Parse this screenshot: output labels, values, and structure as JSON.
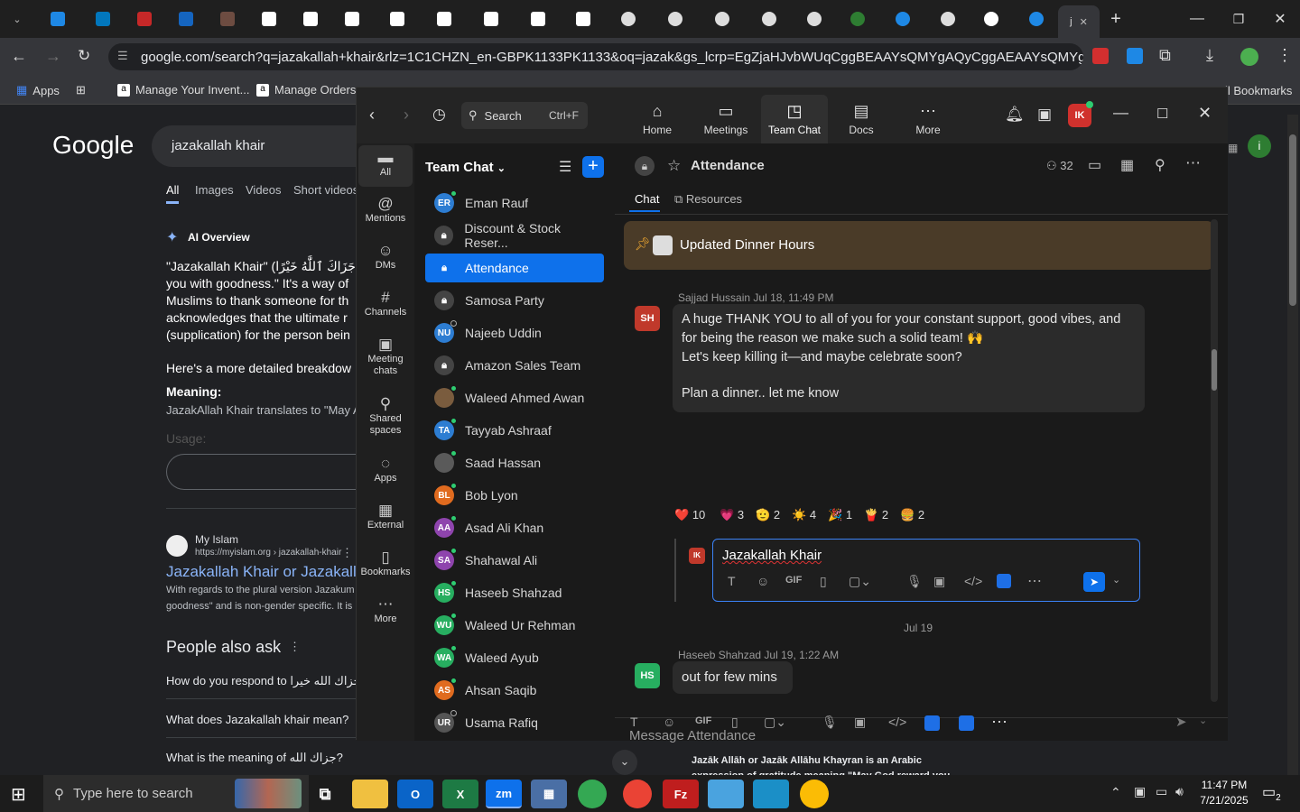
{
  "browser": {
    "url": "google.com/search?q=jazakallah+khair&rlz=1C1CHZN_en-GBPK1133PK1133&oq=jazak&gs_lcrp=EgZjaHJvbWUqCggBEAAYsQMYgAQyCggAEAAYsQMYg...",
    "bookmarks": [
      "Apps",
      "Manage Your Invent...",
      "Manage Orders",
      "All Bookmarks"
    ]
  },
  "google": {
    "search_query": "jazakallah khair",
    "tabs": [
      "All",
      "Images",
      "Videos",
      "Short videos"
    ],
    "ai_overview_label": "AI Overview",
    "overview_lines": [
      "\"Jazakallah Khair\" (جَزَاكَ ٱللَّٰهُ خَيْرًا) is",
      "you with goodness.\" It's a way of",
      "Muslims to thank someone for th",
      "acknowledges that the ultimate r",
      "(supplication) for the person bein",
      "Here's a more detailed breakdow",
      "Meaning:",
      "JazakAllah Khair translates to \"May A",
      "Usage:"
    ],
    "result_site": "My Islam",
    "result_url": "https://myislam.org › jazakallah-khair",
    "result_title": "Jazakallah Khair or Jazakalla",
    "result_snippet_1": "With regards to the plural version Jazakum",
    "result_snippet_2": "goodness\" and is non-gender specific. It is",
    "paa_title": "People also ask",
    "paa": [
      "How do you respond to جزاك الله خيرا?",
      "What does Jazakallah khair mean?",
      "What is the meaning of جزاك الله?"
    ],
    "bottom_snippet_1": "Jazāk Allāh or Jazāk Allāhu Khayran is an Arabic",
    "bottom_snippet_2": "expression of gratitude meaning \"May God reward you"
  },
  "zoom": {
    "search_label": "Search",
    "search_shortcut": "Ctrl+F",
    "top_tabs": [
      {
        "label": "Home",
        "icon": "⌂"
      },
      {
        "label": "Meetings",
        "icon": "▭"
      },
      {
        "label": "Team Chat",
        "icon": "◳"
      },
      {
        "label": "Docs",
        "icon": "▤"
      },
      {
        "label": "More",
        "icon": "⋯"
      }
    ],
    "avatar_initials": "IK",
    "sidebar": [
      {
        "label": "All",
        "icon": "▬"
      },
      {
        "label": "Mentions",
        "icon": "@"
      },
      {
        "label": "DMs",
        "icon": "☺"
      },
      {
        "label": "Channels",
        "icon": "#"
      },
      {
        "label": "Meeting chats",
        "icon": "▣"
      },
      {
        "label": "Shared spaces",
        "icon": "⚲"
      },
      {
        "label": "Apps",
        "icon": "◌"
      },
      {
        "label": "External",
        "icon": "▦"
      },
      {
        "label": "Bookmarks",
        "icon": "▯"
      },
      {
        "label": "More",
        "icon": "⋯"
      }
    ],
    "list_title": "Team Chat",
    "list": [
      {
        "label": "Eman Rauf",
        "initials": "ER",
        "color": "#2d7dd2",
        "status": "on"
      },
      {
        "label": "Discount & Stock Reser...",
        "initials": "",
        "color": "#555",
        "status": "lock"
      },
      {
        "label": "Attendance",
        "initials": "",
        "color": "#0e71eb",
        "status": "lock",
        "selected": true
      },
      {
        "label": "Samosa Party",
        "initials": "",
        "color": "#555",
        "status": "lock"
      },
      {
        "label": "Najeeb Uddin",
        "initials": "NU",
        "color": "#2d7dd2",
        "status": "off"
      },
      {
        "label": "Amazon Sales Team",
        "initials": "",
        "color": "#555",
        "status": "lock"
      },
      {
        "label": "Waleed Ahmed Awan",
        "initials": "",
        "color": "#7a5c3e",
        "status": "on"
      },
      {
        "label": "Tayyab Ashraaf",
        "initials": "TA",
        "color": "#2d7dd2",
        "status": "on"
      },
      {
        "label": "Saad Hassan",
        "initials": "",
        "color": "#5a5a5a",
        "status": "on"
      },
      {
        "label": "Bob Lyon",
        "initials": "BL",
        "color": "#e06b1f",
        "status": "on"
      },
      {
        "label": "Asad Ali Khan",
        "initials": "AA",
        "color": "#8e44ad",
        "status": "on"
      },
      {
        "label": "Shahawal Ali",
        "initials": "SA",
        "color": "#8e44ad",
        "status": "on"
      },
      {
        "label": "Haseeb Shahzad",
        "initials": "HS",
        "color": "#27ae60",
        "status": "on"
      },
      {
        "label": "Waleed Ur Rehman",
        "initials": "WU",
        "color": "#27ae60",
        "status": "on"
      },
      {
        "label": "Waleed Ayub",
        "initials": "WA",
        "color": "#27ae60",
        "status": "on"
      },
      {
        "label": "Ahsan Saqib",
        "initials": "AS",
        "color": "#e06b1f",
        "status": "on"
      },
      {
        "label": "Usama Rafiq",
        "initials": "UR",
        "color": "#555",
        "status": "off"
      }
    ],
    "channel": {
      "name": "Attendance",
      "member_count": "32",
      "tabs": [
        "Chat",
        "Resources"
      ],
      "pinned": "Updated Dinner Hours",
      "msg1_author": "Sajjad Hussain",
      "msg1_time": "Jul 18, 11:49 PM",
      "msg1_initials": "SH",
      "msg1_lines": [
        "A huge THANK YOU to all of you for your constant support, good vibes, and",
        "for being the reason we make such a solid team! 🙌",
        "Let's keep killing it—and maybe celebrate soon?",
        "",
        "Plan a dinner.. let me know"
      ],
      "reactions": [
        {
          "emoji": "❤️",
          "count": "10"
        },
        {
          "emoji": "💗",
          "count": "3"
        },
        {
          "emoji": "🫡",
          "count": "2"
        },
        {
          "emoji": "☀️",
          "count": "4"
        },
        {
          "emoji": "🎉",
          "count": "1"
        },
        {
          "emoji": "🍟",
          "count": "2"
        },
        {
          "emoji": "🍔",
          "count": "2"
        }
      ],
      "reply_initials": "IK",
      "reply_text": "Jazakallah Khair",
      "date_divider": "Jul 19",
      "msg2_author": "Haseeb Shahzad",
      "msg2_time": "Jul 19, 1:22 AM",
      "msg2_initials": "HS",
      "msg2_text": "out for few mins",
      "composer_placeholder": "Message Attendance"
    }
  },
  "taskbar": {
    "search_placeholder": "Type here to search",
    "time": "11:47 PM",
    "date": "7/21/2025",
    "notifications": "2"
  }
}
